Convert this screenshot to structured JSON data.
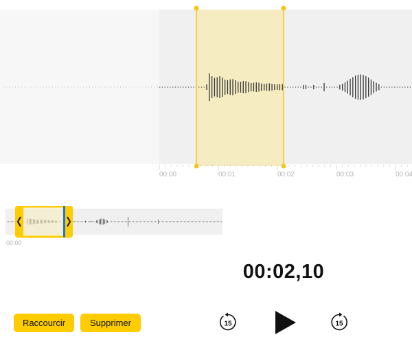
{
  "timeline": {
    "ticks": [
      "00:00",
      "00:01",
      "00:02",
      "00:03",
      "00:04"
    ]
  },
  "overview": {
    "tick": "00:00"
  },
  "playback": {
    "current_time": "00:02,10"
  },
  "actions": {
    "trim_label": "Raccourcir",
    "delete_label": "Supprimer"
  },
  "controls": {
    "skip_back_label": "15",
    "skip_forward_label": "15"
  },
  "colors": {
    "selection_fill": "#f5ecc2",
    "handle": "#f5c518",
    "button_yellow": "#ffcc00",
    "playhead": "#1a73e8"
  }
}
